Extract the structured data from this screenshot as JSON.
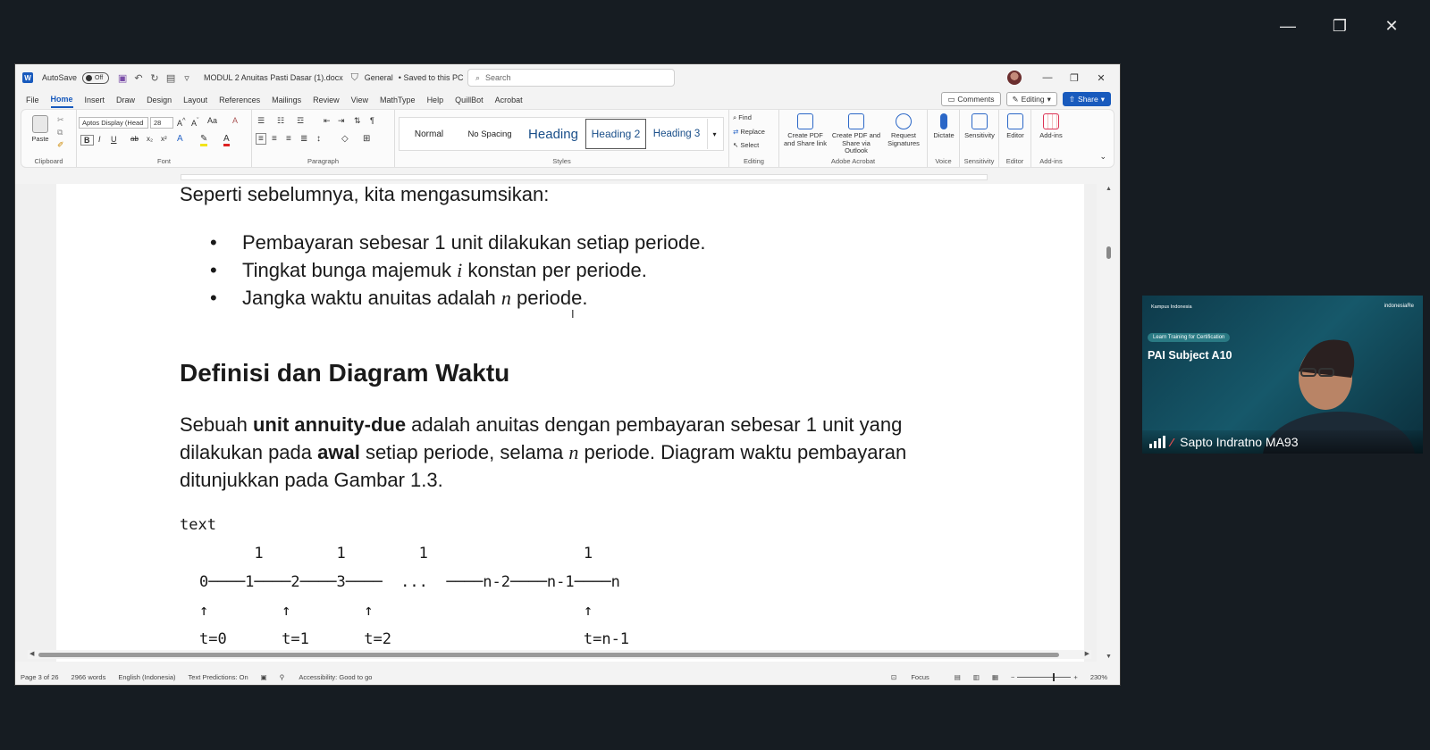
{
  "outer_controls": {
    "minimize": "—",
    "restore": "❐",
    "close": "✕"
  },
  "titlebar": {
    "autosave_label": "AutoSave",
    "autosave_state": "Off",
    "filename": "MODUL 2 Anuitas Pasti Dasar (1).docx",
    "sensitivity": "General",
    "saved_status": "• Saved to this PC",
    "search_placeholder": "Search"
  },
  "tabs": [
    "File",
    "Home",
    "Insert",
    "Draw",
    "Design",
    "Layout",
    "References",
    "Mailings",
    "Review",
    "View",
    "MathType",
    "Help",
    "QuillBot",
    "Acrobat"
  ],
  "tab_buttons": {
    "comments": "Comments",
    "editing": "Editing",
    "share": "Share"
  },
  "ribbon": {
    "clipboard": {
      "paste": "Paste",
      "label": "Clipboard"
    },
    "font": {
      "name": "Aptos Display (Head",
      "size": "28",
      "label": "Font"
    },
    "paragraph": {
      "label": "Paragraph"
    },
    "styles": {
      "items": [
        "Normal",
        "No Spacing",
        "Heading",
        "Heading 2",
        "Heading 3"
      ],
      "label": "Styles"
    },
    "editing": {
      "find": "Find",
      "replace": "Replace",
      "select": "Select",
      "label": "Editing"
    },
    "acrobat": {
      "create_pdf": "Create PDF and Share link",
      "create_pdf_outlook": "Create PDF and Share via Outlook",
      "request_sig": "Request Signatures",
      "label": "Adobe Acrobat"
    },
    "voice": {
      "dictate": "Dictate",
      "label": "Voice"
    },
    "sensitivity": {
      "btn": "Sensitivity",
      "label": "Sensitivity"
    },
    "editor": {
      "btn": "Editor",
      "label": "Editor"
    },
    "addins": {
      "btn": "Add-ins",
      "label": "Add-ins"
    }
  },
  "document": {
    "intro": "Seperti sebelumnya, kita mengasumsikan:",
    "bullets": [
      {
        "before": "Pembayaran sebesar 1 unit dilakukan setiap periode.",
        "var": "",
        "after": ""
      },
      {
        "before": "Tingkat bunga majemuk ",
        "var": "i",
        "after": " konstan per periode."
      },
      {
        "before": "Jangka waktu anuitas adalah ",
        "var": "n",
        "after": " periode."
      }
    ],
    "heading": "Definisi dan Diagram Waktu",
    "para": {
      "p1": "Sebuah ",
      "b1": "unit annuity-due",
      "p2": " adalah anuitas dengan pembayaran sebesar 1 unit yang",
      "p3": "dilakukan pada ",
      "b2": "awal",
      "p4": " setiap periode, selama ",
      "v1": "n",
      "p5": " periode. Diagram waktu pembayaran",
      "p6": "ditunjukkan pada Gambar 1.3."
    },
    "code_label": "text",
    "code_lines": [
      "      1        1        1                 1",
      "0────1────2────3────  ...  ────n-2────n-1────n",
      "↑        ↑        ↑                       ↑",
      "t=0      t=1      t=2                     t=n-1"
    ]
  },
  "statusbar": {
    "page": "Page 3 of 26",
    "words": "2966 words",
    "language": "English (Indonesia)",
    "predictions": "Text Predictions: On",
    "accessibility": "Accessibility: Good to go",
    "focus": "Focus",
    "zoom": "230%"
  },
  "video": {
    "brand_left": "Kampus Indonesia",
    "brand_right": "indonesiaRe",
    "tag": "Learn Training for Certification",
    "title": "PAI Subject A10",
    "name": "Sapto Indratno MA93"
  }
}
